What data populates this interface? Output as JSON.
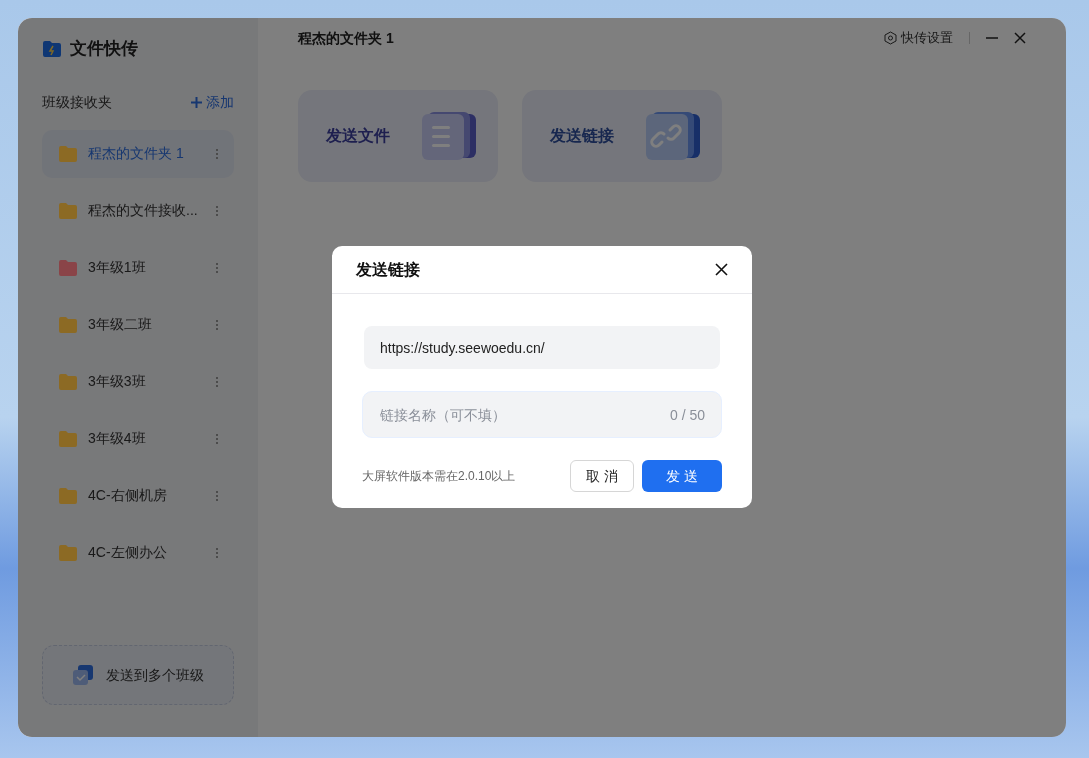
{
  "app": {
    "title": "文件快传"
  },
  "sidebar": {
    "heading": "班级接收夹",
    "add_button": "添加",
    "folders": [
      {
        "name": "程杰的文件夹 1",
        "selected": true,
        "color": "#8c6a24"
      },
      {
        "name": "程杰的文件接收...",
        "selected": false,
        "color": "#8c6a24"
      },
      {
        "name": "3年级1班",
        "selected": false,
        "color": "#8a4448"
      },
      {
        "name": "3年级二班",
        "selected": false,
        "color": "#8c6a24"
      },
      {
        "name": "3年级3班",
        "selected": false,
        "color": "#8c6a24"
      },
      {
        "name": "3年级4班",
        "selected": false,
        "color": "#8c6a24"
      },
      {
        "name": "4C-右侧机房",
        "selected": false,
        "color": "#8c6a24"
      },
      {
        "name": "4C-左侧办公",
        "selected": false,
        "color": "#8c6a24"
      }
    ],
    "multi_send_button": "发送到多个班级"
  },
  "header": {
    "folder_title": "程杰的文件夹 1",
    "settings_button": "快传设置"
  },
  "actions": [
    {
      "kind": "file",
      "label": "发送文件"
    },
    {
      "kind": "link",
      "label": "发送链接"
    }
  ],
  "dialog": {
    "title": "发送链接",
    "url_value": "https://study.seewoedu.cn/",
    "name_placeholder": "链接名称（可不填）",
    "name_counter": "0 / 50",
    "note": "大屏软件版本需在2.0.10以上",
    "cancel_button": "取 消",
    "send_button": "发 送"
  }
}
